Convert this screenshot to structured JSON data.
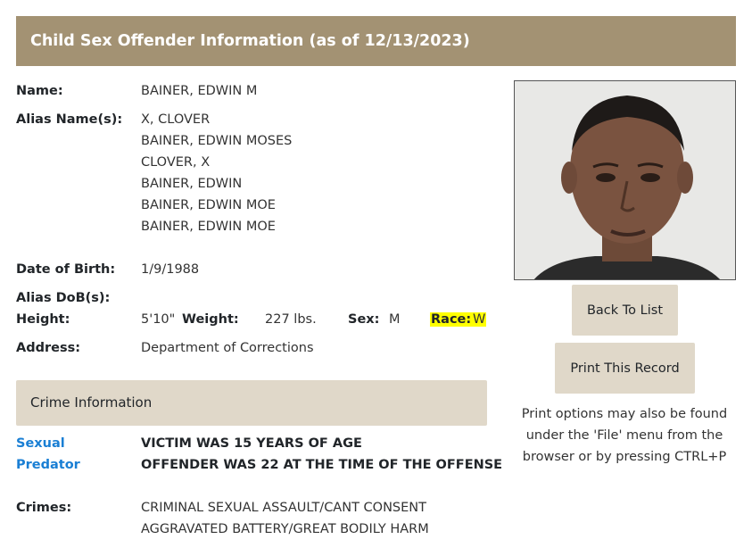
{
  "header": {
    "title": "Child Sex Offender Information (as of 12/13/2023)"
  },
  "details": {
    "name_label": "Name:",
    "name": "BAINER, EDWIN M",
    "alias_label": "Alias Name(s):",
    "aliases": [
      "X, CLOVER",
      "BAINER, EDWIN MOSES",
      "CLOVER, X",
      "BAINER, EDWIN",
      "BAINER, EDWIN MOE",
      "BAINER, EDWIN MOE"
    ],
    "dob_label": "Date of Birth:",
    "dob": "1/9/1988",
    "alias_dob_label": "Alias DoB(s):",
    "height_label": "Height:",
    "height": "5'10\"",
    "weight_label": "Weight:",
    "weight": "227 lbs.",
    "sex_label": "Sex:",
    "sex": "M",
    "race_label": "Race:",
    "race": "W",
    "address_label": "Address:",
    "address": "Department of Corrections"
  },
  "crime": {
    "section_title": "Crime Information",
    "status_line1": "Sexual",
    "status_line2": "Predator",
    "note1": "VICTIM WAS 15 YEARS OF AGE",
    "note2": "OFFENDER WAS 22 AT THE TIME OF THE OFFENSE",
    "crimes_label": "Crimes:",
    "crimes": [
      "CRIMINAL SEXUAL ASSAULT/CANT CONSENT",
      "AGGRAVATED BATTERY/GREAT BODILY HARM"
    ]
  },
  "sidebar": {
    "back_button": "Back To List",
    "print_button": "Print This Record",
    "print_note": "Print options may also be found under the 'File' menu from the browser or by pressing CTRL+P"
  }
}
